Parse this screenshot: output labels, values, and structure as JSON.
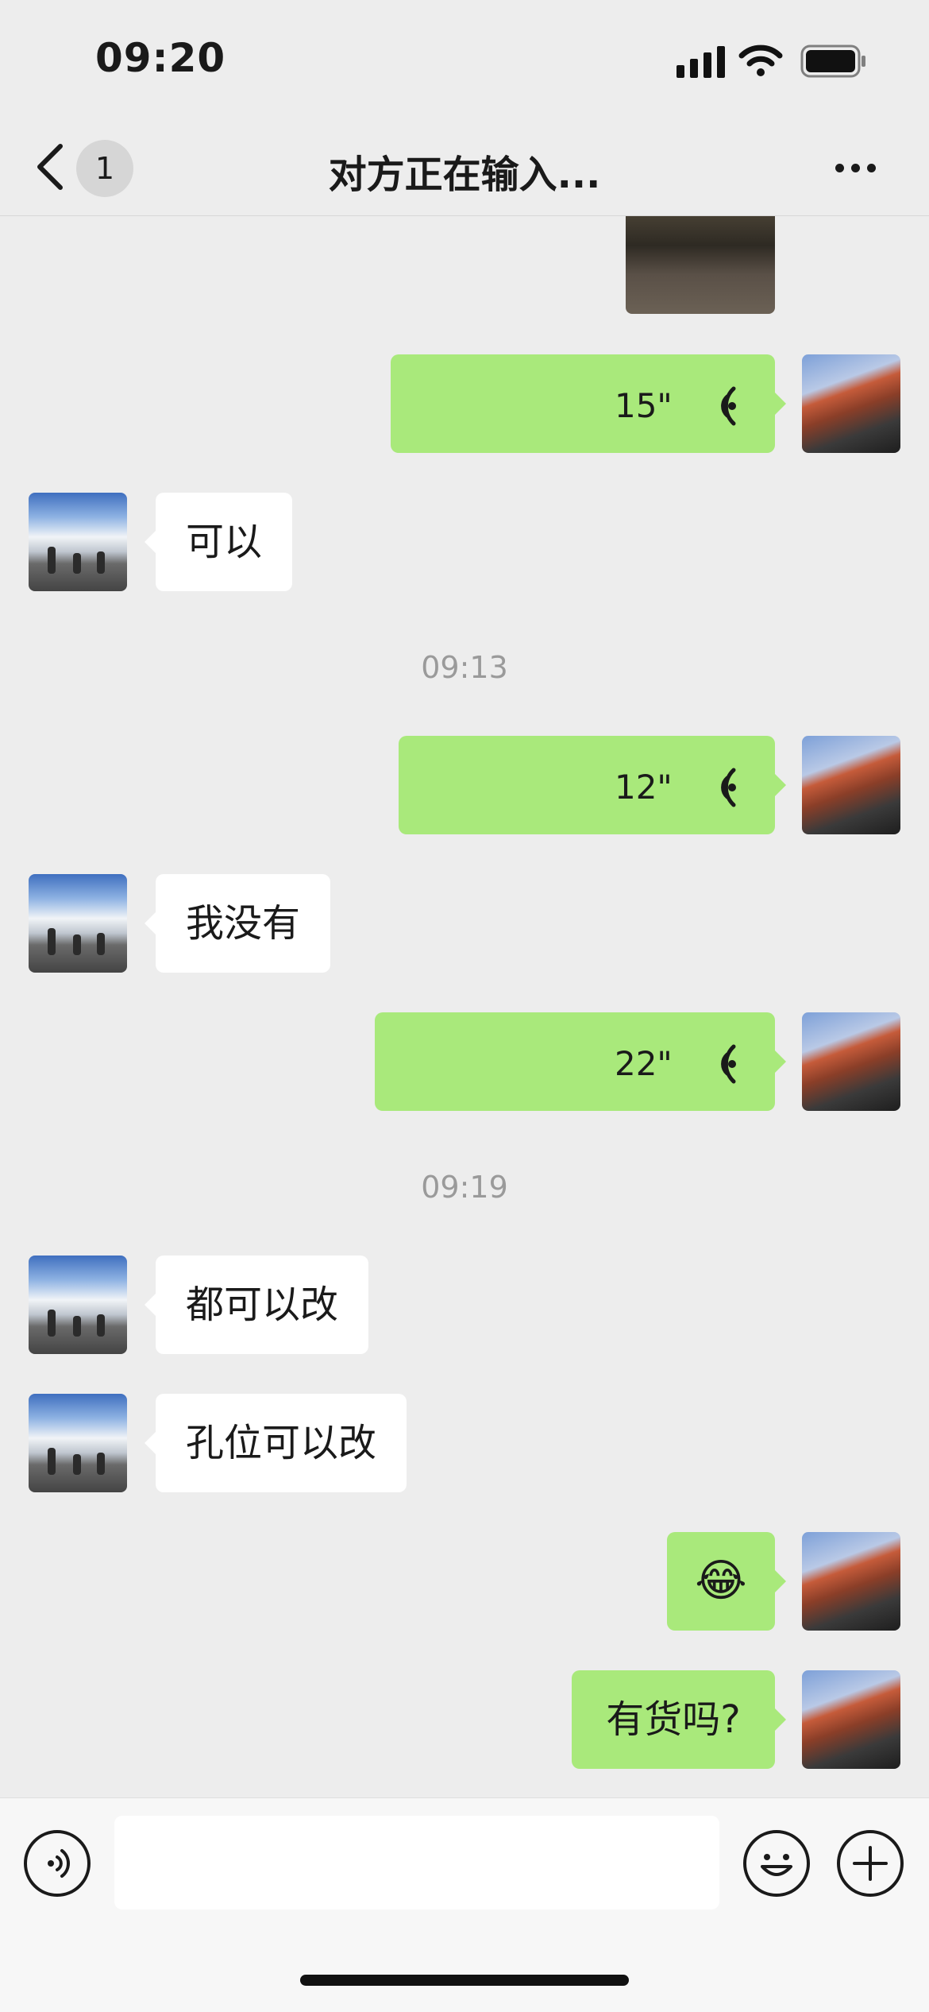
{
  "status_bar": {
    "time": "09:20"
  },
  "nav": {
    "back_count": "1",
    "title": "对方正在输入..."
  },
  "messages": [
    {
      "type": "image",
      "side": "right"
    },
    {
      "type": "voice",
      "side": "right",
      "duration": "15\""
    },
    {
      "type": "text",
      "side": "left",
      "text": "可以"
    },
    {
      "type": "timestamp",
      "text": "09:13"
    },
    {
      "type": "voice",
      "side": "right",
      "duration": "12\""
    },
    {
      "type": "text",
      "side": "left",
      "text": "我没有"
    },
    {
      "type": "voice",
      "side": "right",
      "duration": "22\""
    },
    {
      "type": "timestamp",
      "text": "09:19"
    },
    {
      "type": "text",
      "side": "left",
      "text": "都可以改"
    },
    {
      "type": "text",
      "side": "left",
      "text": "孔位可以改"
    },
    {
      "type": "emoji",
      "side": "right",
      "text": "😂"
    },
    {
      "type": "text",
      "side": "right",
      "text": "有货吗?"
    }
  ],
  "input_bar": {
    "placeholder": ""
  },
  "icons": {
    "back": "chevron-left-icon",
    "more": "more-dots-icon",
    "voice_input": "voice-input-icon",
    "emoji": "emoji-icon",
    "add": "plus-icon"
  },
  "colors": {
    "outgoing_bubble": "#a9e97b",
    "incoming_bubble": "#ffffff",
    "background": "#ededed"
  }
}
